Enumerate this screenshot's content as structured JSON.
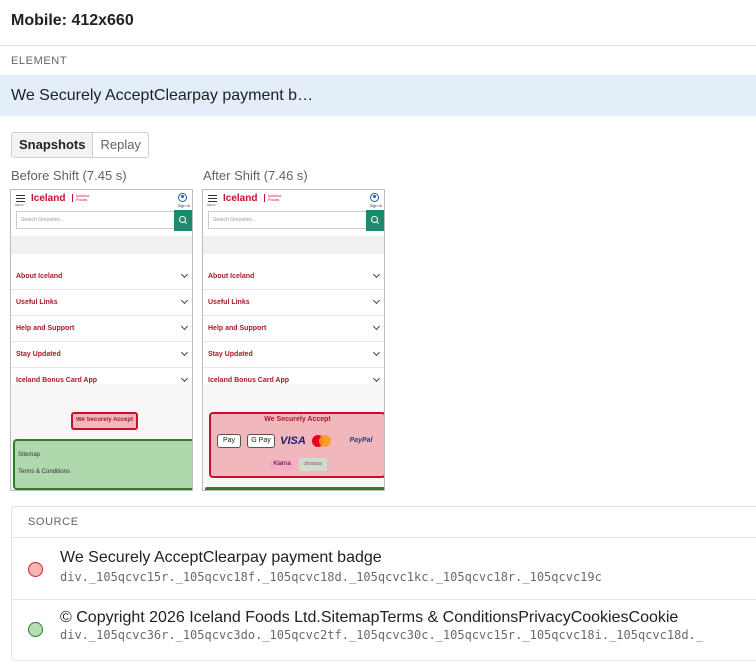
{
  "header": {
    "title": "Mobile: 412x660"
  },
  "element": {
    "section_label": "ELEMENT",
    "text": "We Securely AcceptClearpay payment b…"
  },
  "tabs": [
    {
      "label": "Snapshots",
      "active": true
    },
    {
      "label": "Replay",
      "active": false
    }
  ],
  "snapshots": {
    "before_caption": "Before Shift (7.45 s)",
    "after_caption": "After Shift (7.46 s)"
  },
  "phone": {
    "logo": "Iceland",
    "logo_tag": "Iceland Foods",
    "menu_label": "MENU",
    "sign_in": "Sign In",
    "search_placeholder": "Search Groceries...",
    "accordion": [
      "About Iceland",
      "Useful Links",
      "Help and Support",
      "Stay Updated",
      "Iceland Bonus Card App"
    ],
    "badge_title": "We Securely Accept",
    "footer_links": [
      "Sitemap",
      "Terms & Conditions"
    ],
    "payment_methods": [
      "Pay",
      "G Pay",
      "VISA",
      "PayPal",
      "Klarna",
      "clearpay"
    ]
  },
  "colors": {
    "brand_red": "#c8102e",
    "search_green": "#1e8a6b",
    "shift_red_fill": "#f2b7bd",
    "shift_green_fill": "#afd8ad",
    "highlight_row": "#e3eef8"
  },
  "source": {
    "section_label": "SOURCE",
    "items": [
      {
        "color": "red",
        "text": "We Securely AcceptClearpay payment badge",
        "selector": "div._105qcvc15r._105qcvc18f._105qcvc18d._105qcvc1kc._105qcvc18r._105qcvc19c"
      },
      {
        "color": "green",
        "text": "© Copyright 2026 Iceland Foods Ltd.SitemapTerms & ConditionsPrivacyCookiesCookie",
        "selector": "div._105qcvc36r._105qcvc3do._105qcvc2tf._105qcvc30c._105qcvc15r._105qcvc18i._105qcvc18d._"
      }
    ]
  }
}
